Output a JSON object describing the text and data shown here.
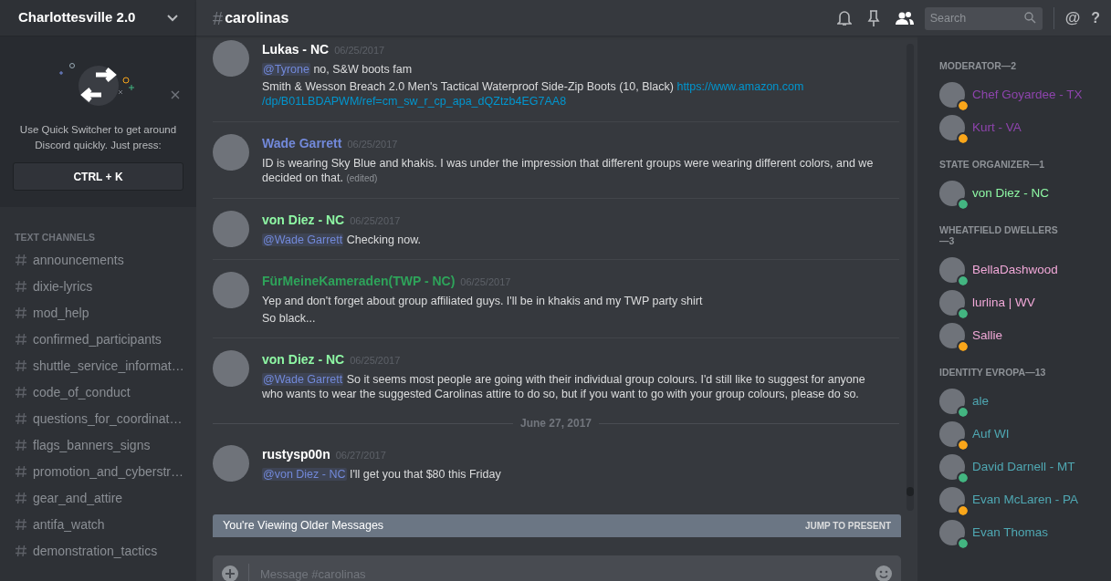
{
  "server": {
    "name": "Charlottesville 2.0"
  },
  "quick_switcher": {
    "text": "Use Quick Switcher to get around Discord quickly. Just press:",
    "shortcut": "CTRL + K"
  },
  "channels": {
    "heading": "TEXT CHANNELS",
    "items": [
      {
        "name": "announcements",
        "selected": false
      },
      {
        "name": "dixie-lyrics",
        "selected": false
      },
      {
        "name": "mod_help",
        "selected": false
      },
      {
        "name": "confirmed_participants",
        "selected": false
      },
      {
        "name": "shuttle_service_informat…",
        "selected": false
      },
      {
        "name": "code_of_conduct",
        "selected": false
      },
      {
        "name": "questions_for_coordinat…",
        "selected": false
      },
      {
        "name": "flags_banners_signs",
        "selected": false
      },
      {
        "name": "promotion_and_cyberstr…",
        "selected": false
      },
      {
        "name": "gear_and_attire",
        "selected": false
      },
      {
        "name": "antifa_watch",
        "selected": false
      },
      {
        "name": "demonstration_tactics",
        "selected": false
      }
    ]
  },
  "header": {
    "hash": "#",
    "channel": "carolinas",
    "search_placeholder": "Search",
    "at": "@",
    "help": "?"
  },
  "messages": [
    {
      "kind": "message",
      "author": "Lukas - NC",
      "color": "#ffffff",
      "time": "06/25/2017",
      "lines": [
        [
          {
            "kind": "mention",
            "text": "@Tyrone"
          },
          {
            "kind": "text",
            "text": " no, S&W boots fam"
          }
        ],
        [
          {
            "kind": "text",
            "text": "Smith & Wesson Breach 2.0 Men's Tactical Waterproof Side-Zip Boots (10, Black) "
          },
          {
            "kind": "link",
            "text": "https://www.amazon.com"
          },
          {
            "kind": "link",
            "text": "/dp/B01LBDAPWM/ref=cm_sw_r_cp_apa_dQZtzb4EG7AA8"
          }
        ]
      ]
    },
    {
      "kind": "message",
      "author": "Wade Garrett",
      "color": "#7289da",
      "time": "06/25/2017",
      "lines": [
        [
          {
            "kind": "text",
            "text": "ID is wearing Sky Blue and khakis. I was under the impression that different groups were wearing different colors, and we decided on that. "
          },
          {
            "kind": "edited",
            "text": "(edited)"
          }
        ]
      ]
    },
    {
      "kind": "message",
      "author": "von Diez - NC",
      "color": "#8ef7a4",
      "time": "06/25/2017",
      "lines": [
        [
          {
            "kind": "mention",
            "text": "@Wade Garrett"
          },
          {
            "kind": "text",
            "text": " Checking now."
          }
        ]
      ]
    },
    {
      "kind": "message",
      "author": "FürMeineKameraden(TWP - NC)",
      "color": "#2ea35a",
      "time": "06/25/2017",
      "lines": [
        [
          {
            "kind": "text",
            "text": "Yep and don't forget about group affiliated guys. I'll be in khakis and my TWP party shirt"
          }
        ],
        [
          {
            "kind": "text",
            "text": "So black..."
          }
        ]
      ]
    },
    {
      "kind": "message",
      "author": "von Diez - NC",
      "color": "#8ef7a4",
      "time": "06/25/2017",
      "lines": [
        [
          {
            "kind": "mention",
            "text": "@Wade Garrett"
          },
          {
            "kind": "text",
            "text": " So it seems most people are going with their individual group colours. I'd still like to suggest for anyone who wants to wear the suggested Carolinas attire to do so, but if you want to go with your group colours, please do so."
          }
        ]
      ]
    },
    {
      "kind": "date",
      "text": "June 27, 2017"
    },
    {
      "kind": "message",
      "author": "rustysp00n",
      "color": "#ffffff",
      "time": "06/27/2017",
      "lines": [
        [
          {
            "kind": "mention",
            "text": "@von Diez - NC"
          },
          {
            "kind": "text",
            "text": " I'll get you that $80 this Friday"
          }
        ]
      ]
    }
  ],
  "older_bar": {
    "text": "You're Viewing Older Messages",
    "action": "JUMP TO PRESENT"
  },
  "composer": {
    "placeholder": "Message #carolinas"
  },
  "members": [
    {
      "heading": "MODERATOR—2",
      "color": "#8e44ad",
      "people": [
        {
          "name": "Chef Goyardee - TX",
          "color": "#faa61a"
        },
        {
          "name": "Kurt - VA",
          "color": "#faa61a"
        }
      ]
    },
    {
      "heading": "STATE ORGANIZER—1",
      "color": "#8ef7a4",
      "people": [
        {
          "name": "von Diez - NC",
          "color": "#43b581"
        }
      ]
    },
    {
      "heading": "WHEATFIELD DWELLERS—3",
      "color": "#f1a8d8",
      "people": [
        {
          "name": "BellaDashwood",
          "color": "#43b581"
        },
        {
          "name": "lurlina | WV",
          "color": "#43b581"
        },
        {
          "name": "Sallie",
          "color": "#faa61a"
        }
      ]
    },
    {
      "heading": "IDENTITY EVROPA—13",
      "color": "#4fa8b3",
      "people": [
        {
          "name": "ale",
          "color": "#43b581"
        },
        {
          "name": "Auf WI",
          "color": "#faa61a"
        },
        {
          "name": "David Darnell - MT",
          "color": "#43b581"
        },
        {
          "name": "Evan McLaren - PA",
          "color": "#faa61a"
        },
        {
          "name": "Evan Thomas",
          "color": "#43b581"
        }
      ]
    }
  ]
}
